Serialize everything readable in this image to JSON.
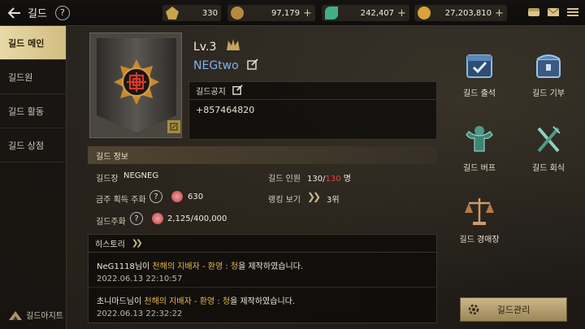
{
  "header": {
    "title": "길드",
    "help": "?",
    "currencies": [
      {
        "value": "330",
        "color": "#c9a44a"
      },
      {
        "value": "97,179",
        "color": "#b58a3c"
      },
      {
        "value": "242,407",
        "color": "#3fae8a"
      },
      {
        "value": "27,203,810",
        "color": "#d9a33a"
      }
    ],
    "plus": "+"
  },
  "sidebar": {
    "items": [
      {
        "label": "길드 메인",
        "active": true
      },
      {
        "label": "길드원",
        "active": false
      },
      {
        "label": "길드 활동",
        "active": false
      },
      {
        "label": "길드 상점",
        "active": false
      }
    ],
    "bottom_label": "길드아지트"
  },
  "guild": {
    "level": "Lv.3",
    "name": "NEGtwo",
    "notice_title": "길드공지",
    "notice_text": "+857464820"
  },
  "info": {
    "header": "길드 정보",
    "leader_label": "길드장",
    "leader_value": "NEGNEG",
    "members_label": "길드 인원",
    "members_current": "130",
    "members_sep": "/",
    "members_max": "130",
    "members_unit": "명",
    "weekly_label": "금주 획득 주화",
    "weekly_value": "630",
    "ranking_label": "랭킹 보기",
    "ranking_value": "3위",
    "coin_label": "길드주화",
    "coin_value": "2,125/400,000"
  },
  "history": {
    "title": "히스토리",
    "entries": [
      {
        "user": "NeG1118님이 ",
        "item": "천해의 지배자 - 환영 : 청",
        "suffix": "을 제작하였습니다.",
        "time": "2022.06.13 22:10:57"
      },
      {
        "user": "초니마드님이 ",
        "item": "천해의 지배자 - 환영 : 청",
        "suffix": "을 제작하였습니다.",
        "time": "2022.06.13 22:32:22"
      }
    ]
  },
  "menu": {
    "attendance": "길드 출석",
    "donation": "길드 기부",
    "buff": "길드 버프",
    "dinner": "길드 회식",
    "auction": "길드 경매장",
    "manage": "길드관리"
  }
}
